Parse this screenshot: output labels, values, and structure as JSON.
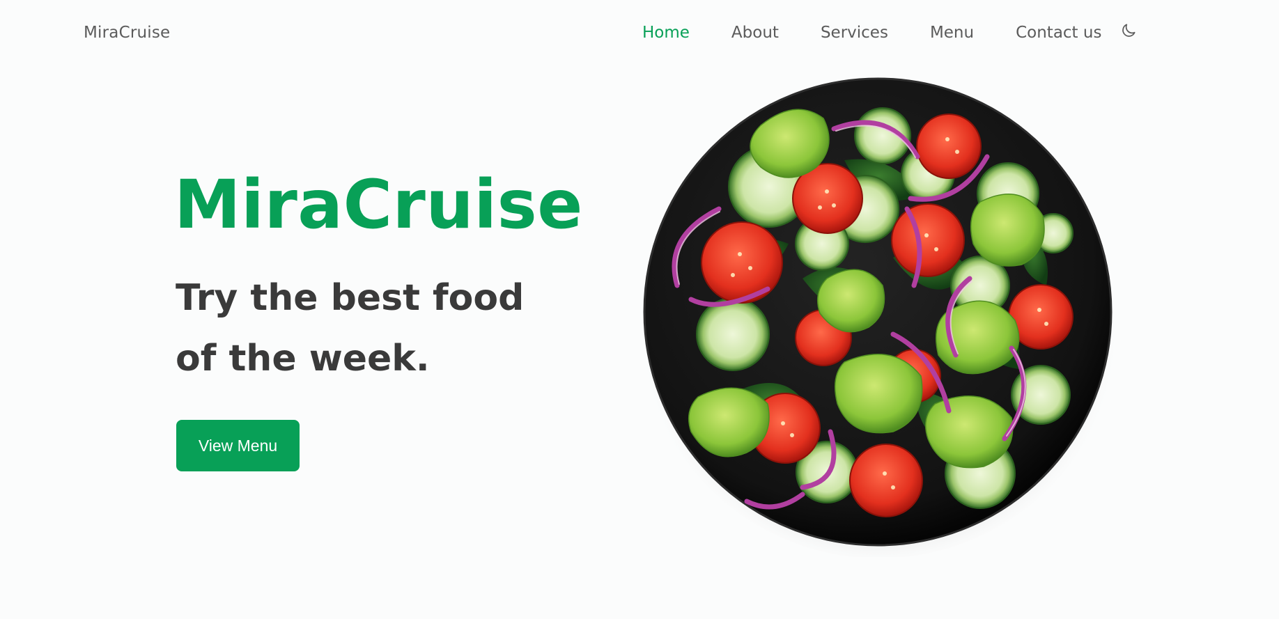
{
  "header": {
    "brand": "MiraCruise",
    "nav": [
      {
        "label": "Home",
        "active": true
      },
      {
        "label": "About",
        "active": false
      },
      {
        "label": "Services",
        "active": false
      },
      {
        "label": "Menu",
        "active": false
      },
      {
        "label": "Contact us",
        "active": false
      }
    ],
    "theme_toggle_icon": "moon-icon"
  },
  "hero": {
    "title": "MiraCruise",
    "subtitle": "Try the best food of the week.",
    "cta_label": "View Menu",
    "image_icon": "salad-bowl-image"
  },
  "colors": {
    "accent": "#08a057",
    "text": "#3a3a3a",
    "muted": "#5b5b5b",
    "background": "#fbfcfc",
    "plate": "#141414"
  }
}
